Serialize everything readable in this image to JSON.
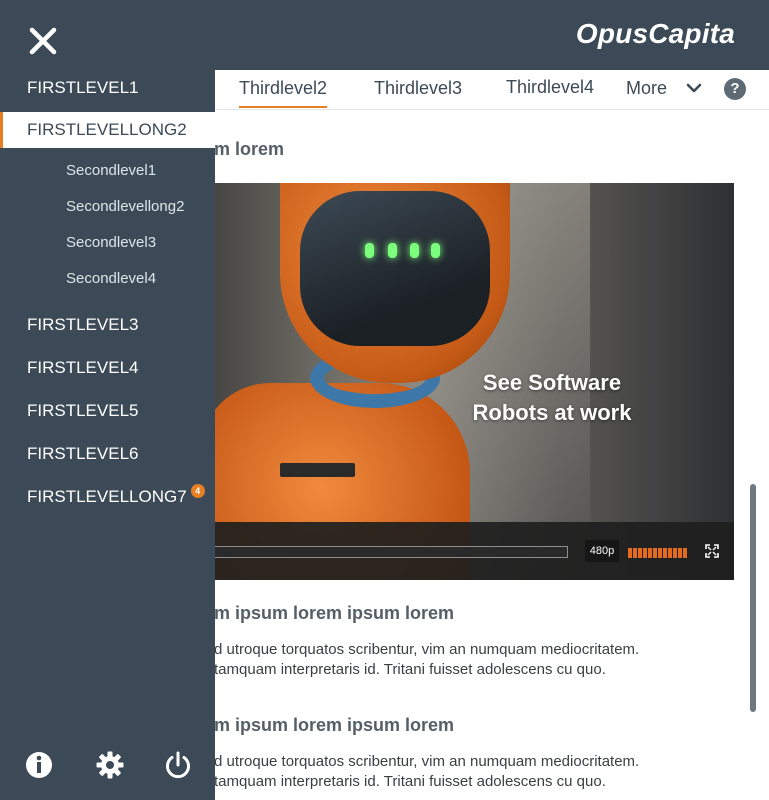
{
  "header": {
    "brand": "OpusCapita"
  },
  "tabs": [
    {
      "label": "Thirdlevel2",
      "active": true
    },
    {
      "label": "Thirdlevel3",
      "active": false
    },
    {
      "label": "Thirdlevel4",
      "active": false
    },
    {
      "label": "More",
      "active": false
    }
  ],
  "help_label": "?",
  "content": {
    "heading_partial": "m lorem",
    "video": {
      "caption_line1": "See Software",
      "caption_line2": "Robots at work",
      "quality": "480p"
    },
    "sections": [
      {
        "title": "m ipsum lorem ipsum lorem",
        "line1": "d utroque torquatos scribentur, vim an numquam mediocritatem.",
        "line2": "tamquam interpretaris id.  Tritani fuisset adolescens cu quo."
      },
      {
        "title": "m ipsum lorem ipsum lorem",
        "line1": "d utroque torquatos scribentur, vim an numquam mediocritatem.",
        "line2": "tamquam interpretaris id.  Tritani fuisset adolescens cu quo."
      }
    ]
  },
  "drawer": {
    "first_level": [
      {
        "label": "FIRSTLEVEL1",
        "active": false
      },
      {
        "label": "FIRSTLEVELLONG2",
        "active": true
      },
      {
        "label": "FIRSTLEVEL3",
        "active": false
      },
      {
        "label": "FIRSTLEVEL4",
        "active": false
      },
      {
        "label": "FIRSTLEVEL5",
        "active": false
      },
      {
        "label": "FIRSTLEVEL6",
        "active": false
      },
      {
        "label": "FIRSTLEVELLONG7",
        "active": false,
        "badge": "4"
      }
    ],
    "second_level": [
      {
        "label": "Secondlevel1"
      },
      {
        "label": "Secondlevellong2"
      },
      {
        "label": "Secondlevel3"
      },
      {
        "label": "Secondlevel4"
      }
    ],
    "footer_icons": [
      "info-icon",
      "gear-icon",
      "power-icon"
    ]
  },
  "colors": {
    "header_bg": "#3b4a56",
    "drawer_bg": "#3b4a56",
    "accent": "#e67e22"
  }
}
